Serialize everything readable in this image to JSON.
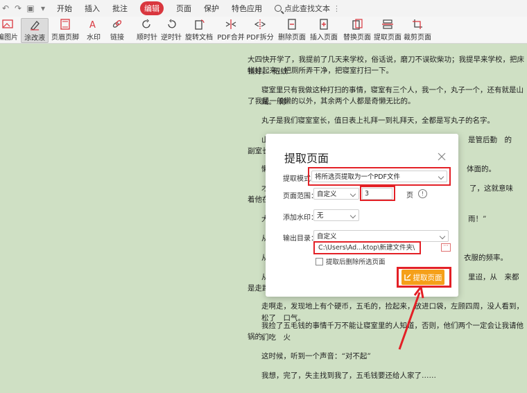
{
  "menubar": {
    "items": [
      "开始",
      "插入",
      "批注",
      "编辑",
      "页面",
      "保护",
      "特色应用"
    ],
    "active": "编辑",
    "search_label": "点此查找文本"
  },
  "toolbar": {
    "tools": [
      {
        "label": "编图片",
        "icon": "image-icon"
      },
      {
        "label": "涂改液",
        "icon": "correction-pen-icon",
        "selected": true
      },
      {
        "label": "页眉页脚",
        "icon": "header-footer-icon"
      },
      {
        "label": "水印",
        "icon": "watermark-icon"
      },
      {
        "label": "链接",
        "icon": "link-icon"
      },
      {
        "label": "顺时针",
        "icon": "rotate-cw-icon"
      },
      {
        "label": "逆时针",
        "icon": "rotate-ccw-icon"
      },
      {
        "label": "旋转文档",
        "icon": "rotate-doc-icon"
      },
      {
        "label": "PDF合并",
        "icon": "pdf-merge-icon"
      },
      {
        "label": "PDF拆分",
        "icon": "pdf-split-icon"
      },
      {
        "label": "删除页面",
        "icon": "delete-page-icon"
      },
      {
        "label": "插入页面",
        "icon": "insert-page-icon"
      },
      {
        "label": "替换页面",
        "icon": "replace-page-icon"
      },
      {
        "label": "提取页面",
        "icon": "extract-page-icon"
      },
      {
        "label": "裁剪页面",
        "icon": "crop-page-icon"
      }
    ],
    "accent": "#d9363e"
  },
  "document": {
    "lines": [
      "大四快开学了，我提前了几天来学校，俗话说，磨刀不误砍柴功；我提早来学校，把床铺好，　把蚊",
      "帐挂起来，把厕所弄干净，把寝室打扫一下。",
      "寝室里只有我做这种打扫的事情，寝室有三个人，我一个，丸子一个，还有就是山贼。　除",
      "了我是一般懒的以外，其余两个人都是奇懒无比的。",
      "丸子是我们寝室室长，值日表上礼拜一到礼拜天，全都是写丸子的名字。",
      "山",
      "是管后勤　的",
      "副室长",
      "懒",
      "体面的。",
      "才",
      "了，这就意味",
      "着他在",
      "大",
      "雨！”",
      "从",
      "从",
      "衣服的频率。",
      "从",
      "里迢，从　来都",
      "是走路",
      "走啊走，发现地上有个硬币，五毛的，捡起来，放进口袋，左顾四周，没人看到，松了　口气。",
      "我捡了五毛钱的事情千万不能让寝室里的人知道，否则，他们两个一定会让我请他们吃　火",
      "锅的。",
      "这时候，听到一个声音：“对不起”",
      "我想，完了，失主找到我了，五毛钱要还给人家了……"
    ]
  },
  "dialog": {
    "title": "提取页面",
    "mode_label": "提取模式：",
    "mode_value": "将所选页提取为一个PDF文件",
    "range_label": "页面范围：",
    "range_value": "自定义",
    "range_pages": "3",
    "range_unit": "页",
    "watermark_label": "添加水印：",
    "watermark_value": "无",
    "output_label": "输出目录：",
    "output_value": "自定义",
    "output_path": "C:\\Users\\Ad...ktop\\新建文件夹\\",
    "delete_after_label": "提取后删除所选页面",
    "extract_button": "提取页面",
    "more_button": "···",
    "highlight_color": "#e32026",
    "button_color": "#f5a01a"
  }
}
